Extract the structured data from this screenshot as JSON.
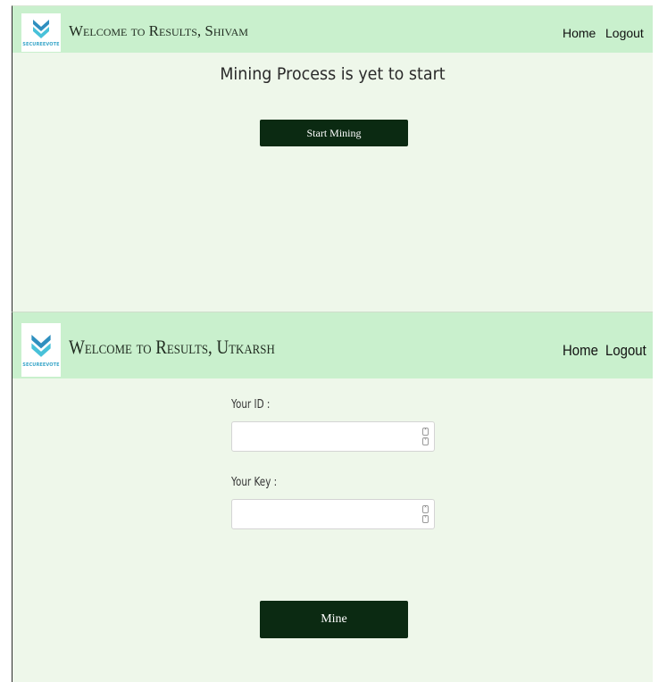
{
  "panel1": {
    "logo_text": "SECUREEVOTE",
    "title": "Welcome to Results, Shivam",
    "nav": {
      "home": "Home",
      "logout": "Logout"
    },
    "status": "Mining Process is yet to start",
    "start_button": "Start Mining"
  },
  "panel2": {
    "logo_text": "SECUREEVOTE",
    "title": "Welcome to Results, Utkarsh",
    "nav": {
      "home": "Home",
      "logout": "Logout"
    },
    "id_label": "Your ID :",
    "id_value": "",
    "key_label": "Your Key :",
    "key_value": "",
    "mine_button": "Mine"
  },
  "colors": {
    "navbar": "#c9f0cd",
    "background": "#eef7ea",
    "button": "#0b2a12",
    "logo_accent": "#3aa6c9"
  },
  "icons": {
    "logo": "securevote-chevron-logo-icon",
    "spin_up": "chevron-up-icon",
    "spin_down": "chevron-down-icon"
  }
}
